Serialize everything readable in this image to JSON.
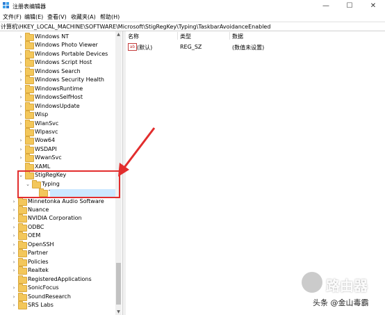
{
  "window": {
    "title": "注册表编辑器",
    "min_glyph": "—",
    "max_glyph": "☐",
    "close_glyph": "✕"
  },
  "menu": {
    "file": "文件(F)",
    "edit": "编辑(E)",
    "view": "查看(V)",
    "favorites": "收藏夹(A)",
    "help": "帮助(H)"
  },
  "address": "计算机\\HKEY_LOCAL_MACHINE\\SOFTWARE\\Microsoft\\StigRegKey\\Typing\\TaskbarAvoidanceEnabled",
  "tree": [
    {
      "label": "Windows NT",
      "expander": "›"
    },
    {
      "label": "Windows Photo Viewer",
      "expander": "›"
    },
    {
      "label": "Windows Portable Devices",
      "expander": "›"
    },
    {
      "label": "Windows Script Host",
      "expander": "›"
    },
    {
      "label": "Windows Search",
      "expander": "›"
    },
    {
      "label": "Windows Security Health",
      "expander": "›"
    },
    {
      "label": "WindowsRuntime",
      "expander": "›"
    },
    {
      "label": "WindowsSelfHost",
      "expander": "›"
    },
    {
      "label": "WindowsUpdate",
      "expander": "›"
    },
    {
      "label": "Wisp",
      "expander": "›"
    },
    {
      "label": "WlanSvc",
      "expander": "›"
    },
    {
      "label": "Wlpasvc",
      "expander": ""
    },
    {
      "label": "Wow64",
      "expander": "›"
    },
    {
      "label": "WSDAPI",
      "expander": "›"
    },
    {
      "label": "WwanSvc",
      "expander": "›"
    },
    {
      "label": "XAML",
      "expander": ""
    },
    {
      "label": "StigRegKey",
      "expander": "⌄"
    },
    {
      "label": "Typing",
      "expander": "⌄"
    },
    {
      "label": "TaskbarAvoidanceEnable",
      "expander": ""
    },
    {
      "label": "Minnetonka Audio Software",
      "expander": "›"
    },
    {
      "label": "Nuance",
      "expander": "›"
    },
    {
      "label": "NVIDIA Corporation",
      "expander": "›"
    },
    {
      "label": "ODBC",
      "expander": "›"
    },
    {
      "label": "OEM",
      "expander": "›"
    },
    {
      "label": "OpenSSH",
      "expander": "›"
    },
    {
      "label": "Partner",
      "expander": "›"
    },
    {
      "label": "Policies",
      "expander": "›"
    },
    {
      "label": "Realtek",
      "expander": "›"
    },
    {
      "label": "RegisteredApplications",
      "expander": ""
    },
    {
      "label": "SonicFocus",
      "expander": "›"
    },
    {
      "label": "SoundResearch",
      "expander": "›"
    },
    {
      "label": "SRS Labs",
      "expander": "›"
    }
  ],
  "list": {
    "col_name": "名称",
    "col_type": "类型",
    "col_data": "数据",
    "row": {
      "icon_text": "ab",
      "name": "(默认)",
      "type": "REG_SZ",
      "data": "(数值未设置)"
    }
  },
  "scroll": {
    "up": "▲",
    "down": "▼"
  },
  "watermark": {
    "brand": "路由器",
    "attribution": "头条 @金山毒霸"
  },
  "colors": {
    "highlight": "#e22d2d",
    "folder": "#f3c75b",
    "selection": "#cce8ff"
  }
}
